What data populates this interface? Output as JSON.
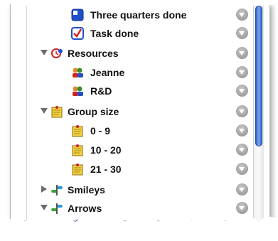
{
  "rows": [
    {
      "label": "Three quarters done",
      "icon": "three-quarters-done-icon",
      "level": 2
    },
    {
      "label": "Task done",
      "icon": "task-done-checkbox-icon",
      "level": 2
    },
    {
      "label": "Resources",
      "icon": "resources-icon",
      "level": 1,
      "expanded": true
    },
    {
      "label": "Jeanne",
      "icon": "person-icon",
      "level": 2
    },
    {
      "label": "R&D",
      "icon": "group-icon",
      "level": 2
    },
    {
      "label": "Group size",
      "icon": "sticky-note-icon",
      "level": 1,
      "expanded": true
    },
    {
      "label": "0 - 9",
      "icon": "sticky-note-icon",
      "level": 2
    },
    {
      "label": "10 - 20",
      "icon": "sticky-note-icon",
      "level": 2
    },
    {
      "label": "21 - 30",
      "icon": "sticky-note-icon",
      "level": 2
    },
    {
      "label": "Smileys",
      "icon": "signpost-icon",
      "level": 1,
      "expanded": false
    },
    {
      "label": "Arrows",
      "icon": "signpost-icon",
      "level": 1,
      "expanded": true
    },
    {
      "label": "Up",
      "icon": "arrow-up-icon",
      "level": 2
    }
  ],
  "scrollbar": {
    "position_fraction": 0,
    "visible_fraction": 0.65
  }
}
